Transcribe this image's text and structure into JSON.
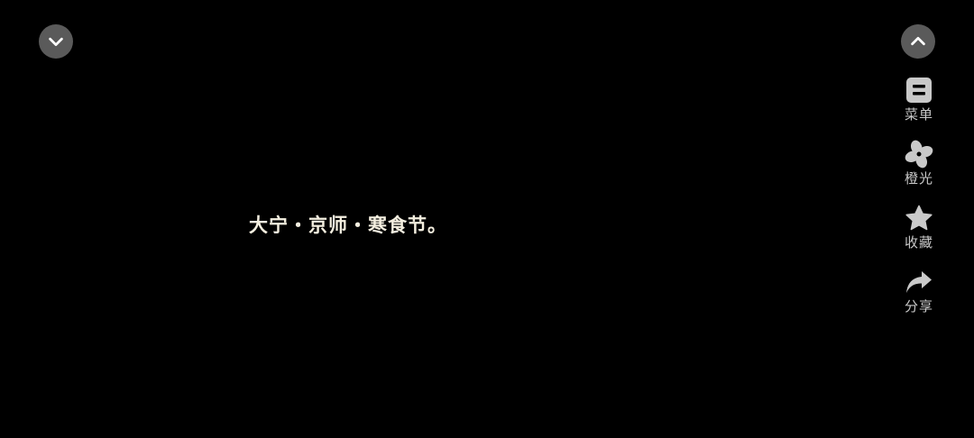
{
  "controls": {
    "collapse_icon": "chevron-down-icon",
    "expand_icon": "chevron-up-icon"
  },
  "side_menu": {
    "items": [
      {
        "label": "菜单",
        "icon": "menu-icon"
      },
      {
        "label": "橙光",
        "icon": "orange-light-icon"
      },
      {
        "label": "收藏",
        "icon": "star-icon"
      },
      {
        "label": "分享",
        "icon": "share-icon"
      }
    ]
  },
  "story": {
    "text": "大宁・京师・寒食节。"
  },
  "colors": {
    "background": "#000000",
    "button_bg": "#5a5a5a",
    "icon": "#c9c9c9",
    "story_text": "#f4efe0"
  }
}
